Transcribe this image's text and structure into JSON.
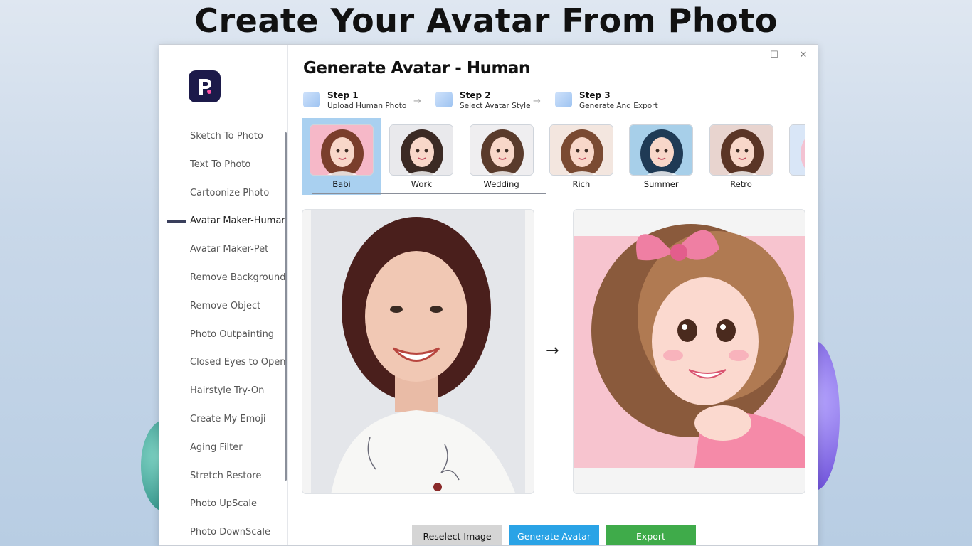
{
  "headline": "Create Your Avatar From Photo",
  "window": {
    "title": "Generate Avatar - Human",
    "controls": {
      "minimize": "—",
      "maximize": "☐",
      "close": "✕"
    }
  },
  "sidebar": {
    "items": [
      {
        "label": "Sketch To Photo"
      },
      {
        "label": "Text To Photo"
      },
      {
        "label": "Cartoonize Photo"
      },
      {
        "label": "Avatar Maker-Human"
      },
      {
        "label": "Avatar Maker-Pet"
      },
      {
        "label": "Remove Background"
      },
      {
        "label": "Remove Object"
      },
      {
        "label": "Photo Outpainting"
      },
      {
        "label": "Closed Eyes to Open"
      },
      {
        "label": "Hairstyle Try-On"
      },
      {
        "label": "Create My Emoji"
      },
      {
        "label": "Aging Filter"
      },
      {
        "label": "Stretch Restore"
      },
      {
        "label": "Photo UpScale"
      },
      {
        "label": "Photo DownScale"
      }
    ],
    "active_index": 3
  },
  "steps": [
    {
      "title": "Step 1",
      "subtitle": "Upload Human Photo"
    },
    {
      "title": "Step 2",
      "subtitle": "Select Avatar Style"
    },
    {
      "title": "Step 3",
      "subtitle": "Generate And Export"
    }
  ],
  "styles": [
    {
      "label": "Babi"
    },
    {
      "label": "Work"
    },
    {
      "label": "Wedding"
    },
    {
      "label": "Rich"
    },
    {
      "label": "Summer"
    },
    {
      "label": "Retro"
    },
    {
      "label": ""
    }
  ],
  "selected_style_index": 0,
  "buttons": {
    "reselect": "Reselect Image",
    "generate": "Generate Avatar",
    "export": "Export"
  },
  "colors": {
    "accent_blue": "#2aa3e6",
    "export_green": "#3fab4a",
    "reselect_gray": "#d5d5d5",
    "selected_card": "#a9d0f0"
  }
}
